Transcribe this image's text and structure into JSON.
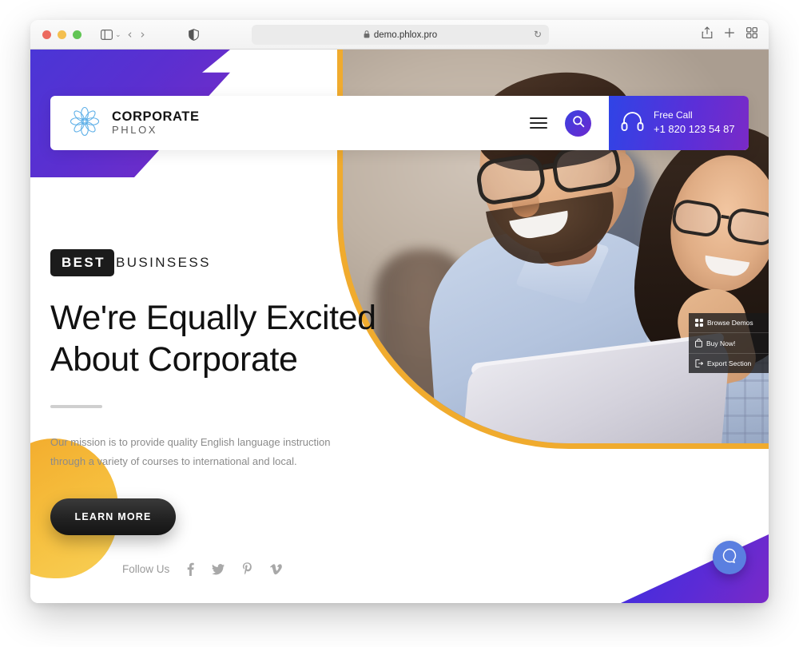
{
  "browser": {
    "url": "demo.phlox.pro",
    "lock_icon": "lock-icon",
    "reload_icon": "reload-icon",
    "shield_icon": "privacy-shield-icon",
    "sidebar_icon": "sidebar-toggle-icon",
    "back_icon": "back-arrow-icon",
    "forward_icon": "forward-arrow-icon",
    "share_icon": "share-icon",
    "new_tab_icon": "plus-icon",
    "tab_overview_icon": "tab-grid-icon",
    "chevron": "⌄",
    "back_glyph": "‹",
    "forward_glyph": "›",
    "reload_glyph": "↻",
    "lock_glyph": "🔒"
  },
  "site_header": {
    "brand_title": "CORPORATE",
    "brand_sub": "PHLOX",
    "logo_icon": "lotus-mandala-logo-icon",
    "menu_icon": "hamburger-menu-icon",
    "search_icon": "search-icon",
    "call": {
      "headphone_icon": "headphone-icon",
      "label": "Free Call",
      "number": "+1 820 123 54 87"
    }
  },
  "hero": {
    "eyebrow_badge": "BEST",
    "eyebrow_rest": "BUSINSESS",
    "headline_line1": "We're Equally Excited",
    "headline_line2": "About Corporate",
    "lead": "Our mission is to provide quality English language instruction through a variety of courses to international and local.",
    "cta": "LEARN MORE"
  },
  "footer": {
    "follow_label": "Follow Us",
    "socials": [
      {
        "name": "facebook-icon",
        "glyph": "f"
      },
      {
        "name": "twitter-icon",
        "glyph": "t"
      },
      {
        "name": "pinterest-icon",
        "glyph": "P"
      },
      {
        "name": "vimeo-icon",
        "glyph": "v"
      }
    ]
  },
  "side_panel": {
    "items": [
      {
        "label": "Browse Demos",
        "icon": "grid-icon"
      },
      {
        "label": "Buy Now!",
        "icon": "shopping-bag-icon"
      },
      {
        "label": "Export Section",
        "icon": "export-icon"
      }
    ]
  },
  "beacon": {
    "icon": "chat-bubble-icon"
  },
  "colors": {
    "purple_start": "#2f44e6",
    "purple_end": "#7a2ac7",
    "orange": "#f2a92b",
    "yellow": "#f6bf3e",
    "dark": "#1b1b1b",
    "beacon_blue": "#5a7fe0"
  }
}
